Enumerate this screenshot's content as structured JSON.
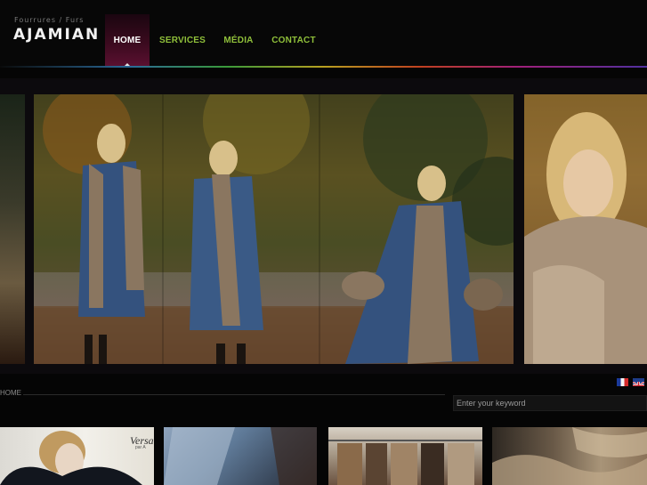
{
  "logo": {
    "tagline": "Fourrures / Furs",
    "name": "AJAMIAN"
  },
  "nav": {
    "items": [
      {
        "label": "HOME",
        "active": true
      },
      {
        "label": "SERVICES",
        "active": false
      },
      {
        "label": "MÉDIA",
        "active": false
      },
      {
        "label": "CONTACT",
        "active": false
      }
    ]
  },
  "breadcrumb": {
    "current": "HOME"
  },
  "languages": [
    {
      "code": "fr",
      "icon": "france-flag-icon"
    },
    {
      "code": "en",
      "icon": "uk-flag-icon"
    }
  ],
  "search": {
    "placeholder": "Enter your keyword",
    "value": ""
  },
  "thumbnails": [
    {
      "caption": "Versa",
      "sub": "par A"
    },
    {
      "caption": ""
    },
    {
      "caption": ""
    },
    {
      "caption": ""
    }
  ],
  "colors": {
    "nav_link": "#8fbf3a",
    "nav_active_bg": "#5a1030",
    "background": "#050505"
  }
}
